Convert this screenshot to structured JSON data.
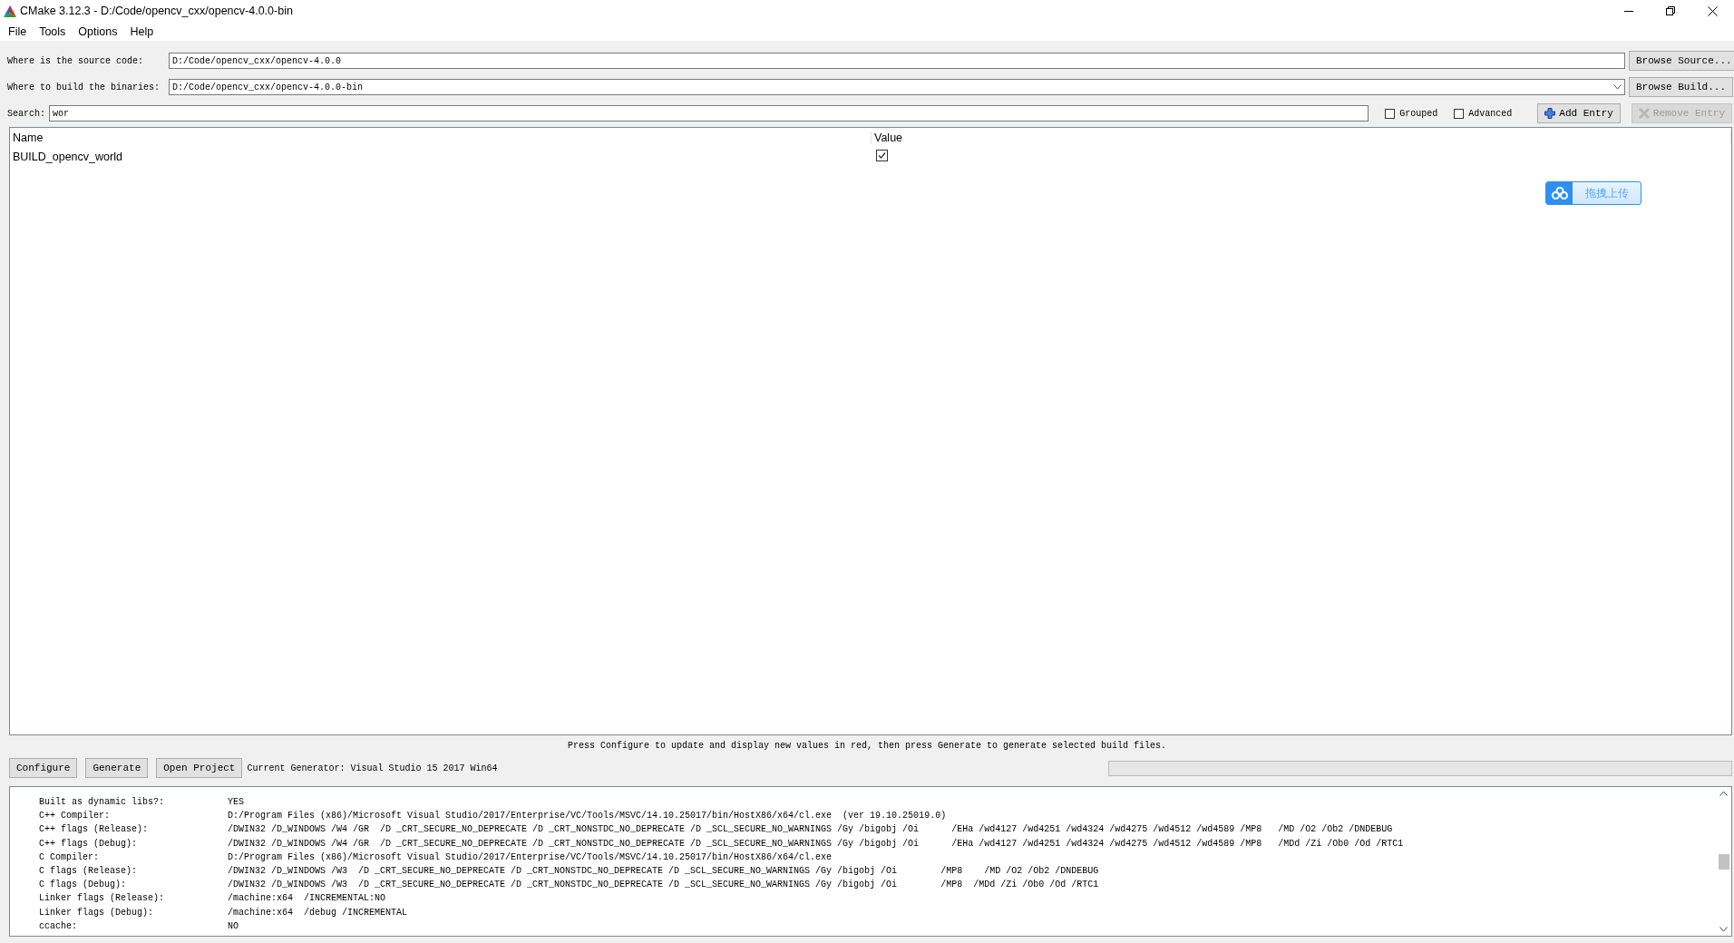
{
  "window": {
    "title": "CMake 3.12.3 - D:/Code/opencv_cxx/opencv-4.0.0-bin"
  },
  "menu": [
    "File",
    "Tools",
    "Options",
    "Help"
  ],
  "paths": [
    {
      "kind": "text",
      "label": "Where is the source code:",
      "value": "D:/Code/opencv_cxx/opencv-4.0.0",
      "button": "Browse Source..."
    },
    {
      "kind": "combo",
      "label": "Where to build the binaries:",
      "value": "D:/Code/opencv_cxx/opencv-4.0.0-bin",
      "button": "Browse Build..."
    }
  ],
  "search": {
    "label": "Search:",
    "value": "wor"
  },
  "options": [
    {
      "label": "Grouped",
      "checked": false
    },
    {
      "label": "Advanced",
      "checked": false
    }
  ],
  "entry_buttons": [
    {
      "kind": "add",
      "label": "Add Entry",
      "disabled": false
    },
    {
      "kind": "remove",
      "label": "Remove Entry",
      "disabled": true
    }
  ],
  "table": {
    "columns": [
      "Name",
      "Value"
    ],
    "rows": [
      {
        "name": "BUILD_opencv_world",
        "checked": true
      }
    ]
  },
  "upload_widget": {
    "label": "拖拽上传"
  },
  "hint": "Press Configure to update and display new values in red, then press Generate to generate selected build files.",
  "actions": [
    "Configure",
    "Generate",
    "Open Project"
  ],
  "generator": "Current Generator: Visual Studio 15 2017 Win64",
  "progress": {
    "level": 0
  },
  "log": [
    {
      "name": "Built as dynamic libs?:",
      "value": "YES"
    },
    {
      "name": "C++ Compiler:",
      "value": "D:/Program Files (x86)/Microsoft Visual Studio/2017/Enterprise/VC/Tools/MSVC/14.10.25017/bin/HostX86/x64/cl.exe  (ver 19.10.25019.0)"
    },
    {
      "name": "C++ flags (Release):",
      "value": "/DWIN32 /D_WINDOWS /W4 /GR  /D _CRT_SECURE_NO_DEPRECATE /D _CRT_NONSTDC_NO_DEPRECATE /D _SCL_SECURE_NO_WARNINGS /Gy /bigobj /Oi      /EHa /wd4127 /wd4251 /wd4324 /wd4275 /wd4512 /wd4589 /MP8   /MD /O2 /Ob2 /DNDEBUG"
    },
    {
      "name": "C++ flags (Debug):",
      "value": "/DWIN32 /D_WINDOWS /W4 /GR  /D _CRT_SECURE_NO_DEPRECATE /D _CRT_NONSTDC_NO_DEPRECATE /D _SCL_SECURE_NO_WARNINGS /Gy /bigobj /Oi      /EHa /wd4127 /wd4251 /wd4324 /wd4275 /wd4512 /wd4589 /MP8   /MDd /Zi /Ob0 /Od /RTC1"
    },
    {
      "name": "C Compiler:",
      "value": "D:/Program Files (x86)/Microsoft Visual Studio/2017/Enterprise/VC/Tools/MSVC/14.10.25017/bin/HostX86/x64/cl.exe"
    },
    {
      "name": "C flags (Release):",
      "value": "/DWIN32 /D_WINDOWS /W3  /D _CRT_SECURE_NO_DEPRECATE /D _CRT_NONSTDC_NO_DEPRECATE /D _SCL_SECURE_NO_WARNINGS /Gy /bigobj /Oi        /MP8    /MD /O2 /Ob2 /DNDEBUG"
    },
    {
      "name": "C flags (Debug):",
      "value": "/DWIN32 /D_WINDOWS /W3  /D _CRT_SECURE_NO_DEPRECATE /D _CRT_NONSTDC_NO_DEPRECATE /D _SCL_SECURE_NO_WARNINGS /Gy /bigobj /Oi        /MP8  /MDd /Zi /Ob0 /Od /RTC1"
    },
    {
      "name": "Linker flags (Release):",
      "value": "/machine:x64  /INCREMENTAL:NO"
    },
    {
      "name": "Linker flags (Debug):",
      "value": "/machine:x64  /debug /INCREMENTAL"
    },
    {
      "name": "ccache:",
      "value": "NO"
    }
  ]
}
